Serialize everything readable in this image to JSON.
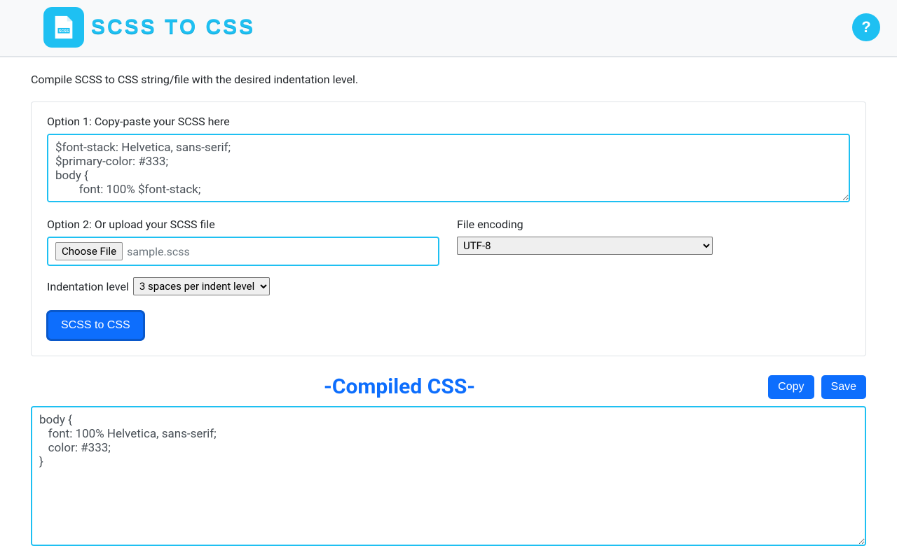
{
  "header": {
    "title": "SCSS to CSS",
    "help_label": "?"
  },
  "description": "Compile SCSS to CSS string/file with the desired indentation level.",
  "panel": {
    "option1_label": "Option 1: Copy-paste your SCSS here",
    "scss_input": "$font-stack: Helvetica, sans-serif;\n$primary-color: #333;\nbody {\n        font: 100% $font-stack;",
    "option2_label": "Option 2: Or upload your SCSS file",
    "choose_file_label": "Choose File",
    "file_name": "sample.scss",
    "encoding_label": "File encoding",
    "encoding_value": "UTF-8",
    "indent_label": "Indentation level",
    "indent_value": "3 spaces per indent level",
    "submit_label": "SCSS to CSS"
  },
  "result": {
    "title": "-Compiled CSS-",
    "copy_label": "Copy",
    "save_label": "Save",
    "output": "body {\n   font: 100% Helvetica, sans-serif;\n   color: #333;\n}"
  }
}
